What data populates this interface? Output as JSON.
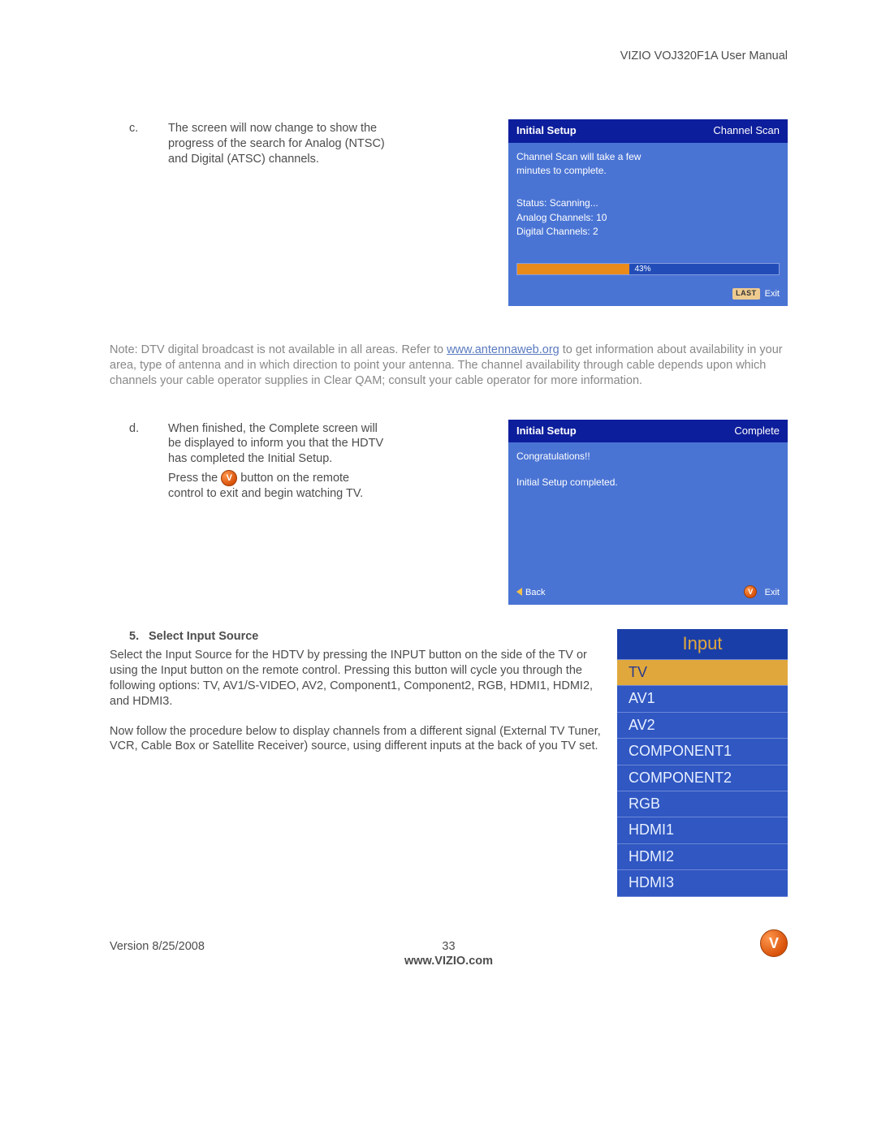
{
  "header": "VIZIO VOJ320F1A User Manual",
  "step_c": {
    "marker": "c.",
    "text": "The screen will now change to show the progress of the search for Analog (NTSC) and Digital (ATSC) channels."
  },
  "osd1": {
    "title": "Initial  Setup",
    "right": "Channel Scan",
    "line1": "Channel Scan will take a few",
    "line2": "minutes to complete.",
    "status": "Status: Scanning...",
    "analog": "Analog Channels: 10",
    "digital": "Digital Channels: 2",
    "percent": "43%",
    "last": "LAST",
    "exit": "Exit"
  },
  "note": {
    "pre": "Note: DTV digital broadcast is not available in all areas.  Refer to ",
    "link": "www.antennaweb.org",
    "post": " to get information about availability in your area, type of antenna and in which direction to point your antenna.  The channel availability through cable depends upon which channels your cable operator supplies in Clear QAM; consult your cable operator for more information."
  },
  "step_d": {
    "marker": "d.",
    "text1": "When finished, the Complete screen will be displayed to inform you that the HDTV has completed the Initial Setup.",
    "press_pre": "Press the ",
    "press_post": " button on the remote control to exit and begin watching TV."
  },
  "osd2": {
    "title": "Initial  Setup",
    "right": "Complete",
    "line1": "Congratulations!!",
    "line2": "Initial Setup completed.",
    "back": "Back",
    "exit": "Exit",
    "v": "V"
  },
  "section5": {
    "num": "5.",
    "heading": "Select Input Source",
    "para1": "Select the Input Source for the HDTV by pressing the INPUT button on the side of the TV or using the Input button on the remote control.  Pressing this button will cycle you through the following options: TV, AV1/S-VIDEO, AV2, Component1, Component2, RGB, HDMI1, HDMI2, and HDMI3.",
    "para2": "Now follow the procedure below to display channels from a different signal (External TV Tuner, VCR, Cable Box or Satellite Receiver) source, using different inputs at the back of you TV set."
  },
  "input_menu": {
    "title": "Input",
    "items": [
      "TV",
      "AV1",
      "AV2",
      "COMPONENT1",
      "COMPONENT2",
      "RGB",
      "HDMI1",
      "HDMI2",
      "HDMI3"
    ],
    "selected_index": 0
  },
  "footer": {
    "version": "Version 8/25/2008",
    "page": "33",
    "site": "www.VIZIO.com",
    "v": "V"
  }
}
